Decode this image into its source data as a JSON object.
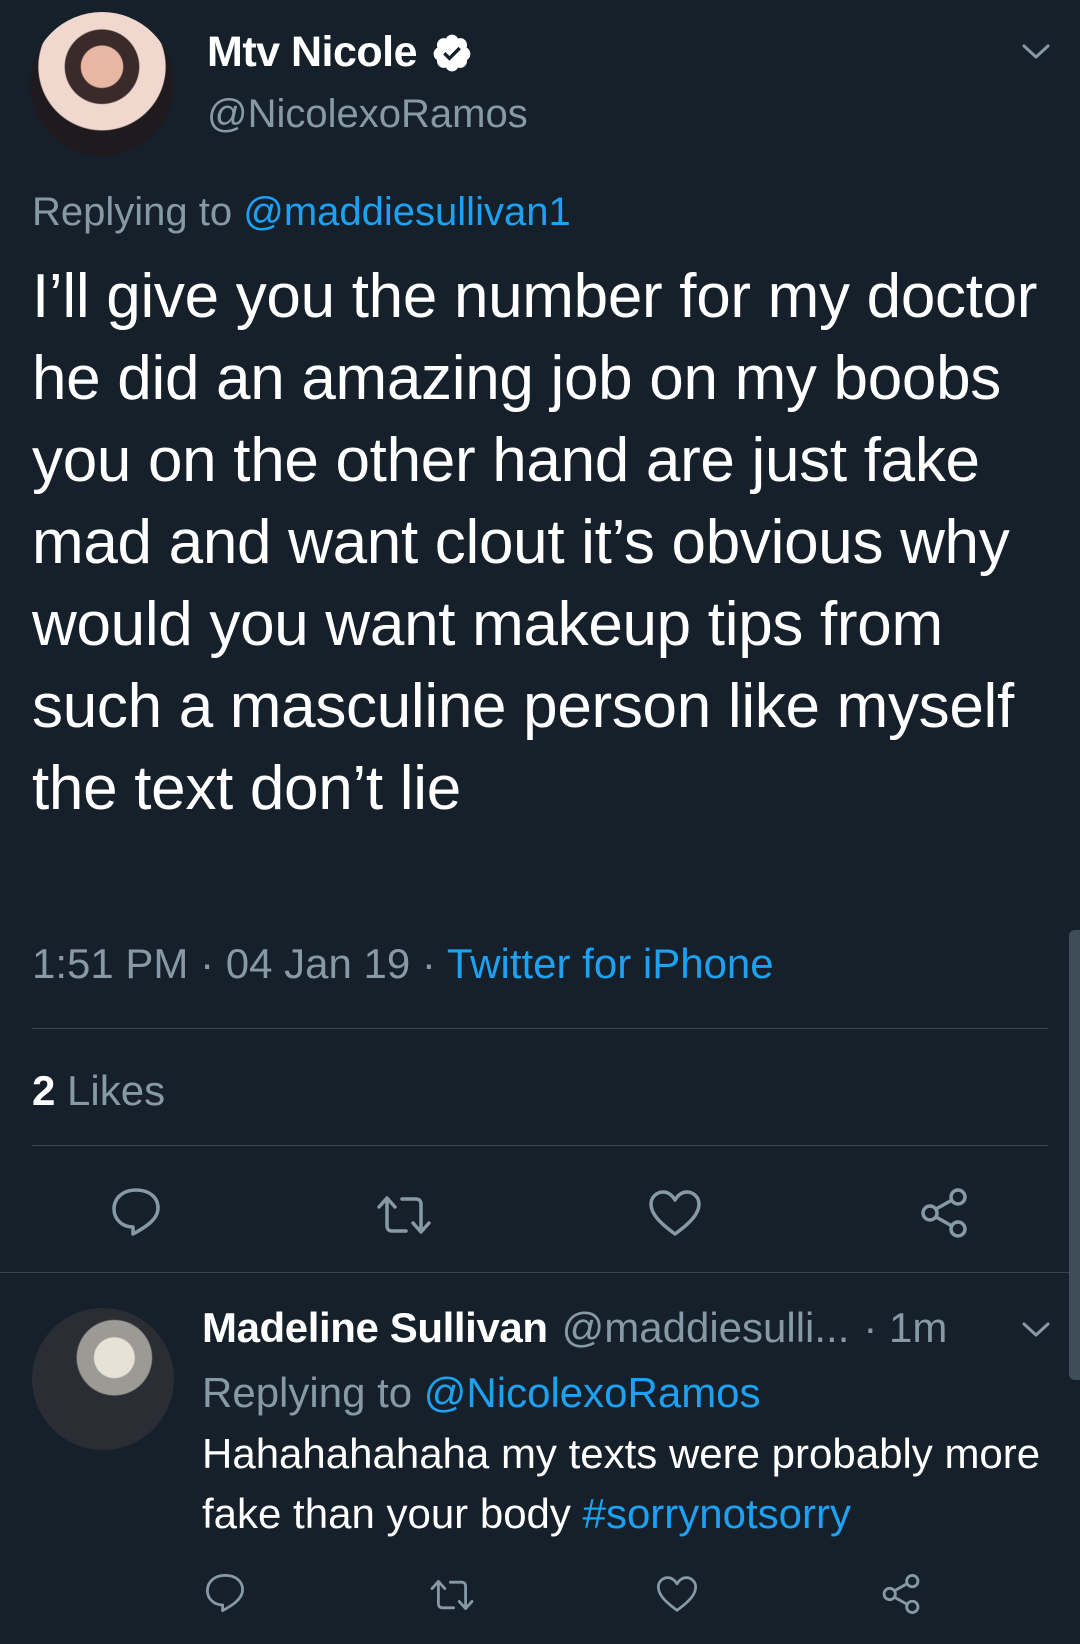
{
  "colors": {
    "background": "#15202b",
    "text_primary": "#ffffff",
    "text_secondary": "#8899a6",
    "link": "#1da1f2",
    "divider": "#38444d"
  },
  "main_tweet": {
    "display_name": "Mtv Nicole",
    "handle": "@NicolexoRamos",
    "verified_icon": "verified-badge-icon",
    "replying_prefix": "Replying to",
    "replying_to": "@maddiesullivan1",
    "text": "I’ll give you the number for my doctor he did an amazing job on my boobs you on the other hand are just fake mad and want clout it’s obvious why would you want makeup tips from such a masculine person like myself the text don’t lie",
    "time": "1:51 PM",
    "separator": " · ",
    "date": "04 Jan 19",
    "source": "Twitter for iPhone",
    "likes_count": "2",
    "likes_label": "Likes",
    "actions": [
      "reply-icon",
      "retweet-icon",
      "like-icon",
      "share-icon"
    ]
  },
  "reply_tweet": {
    "display_name": "Madeline Sullivan",
    "handle": "@maddiesulli...",
    "time": "· 1m",
    "replying_prefix": "Replying to",
    "replying_to": "@NicolexoRamos",
    "text": "Hahahahahaha my texts were probably more fake than your body",
    "hashtag": "#sorrynotsorry",
    "actions": [
      "reply-icon",
      "retweet-icon",
      "like-icon",
      "share-icon"
    ]
  }
}
